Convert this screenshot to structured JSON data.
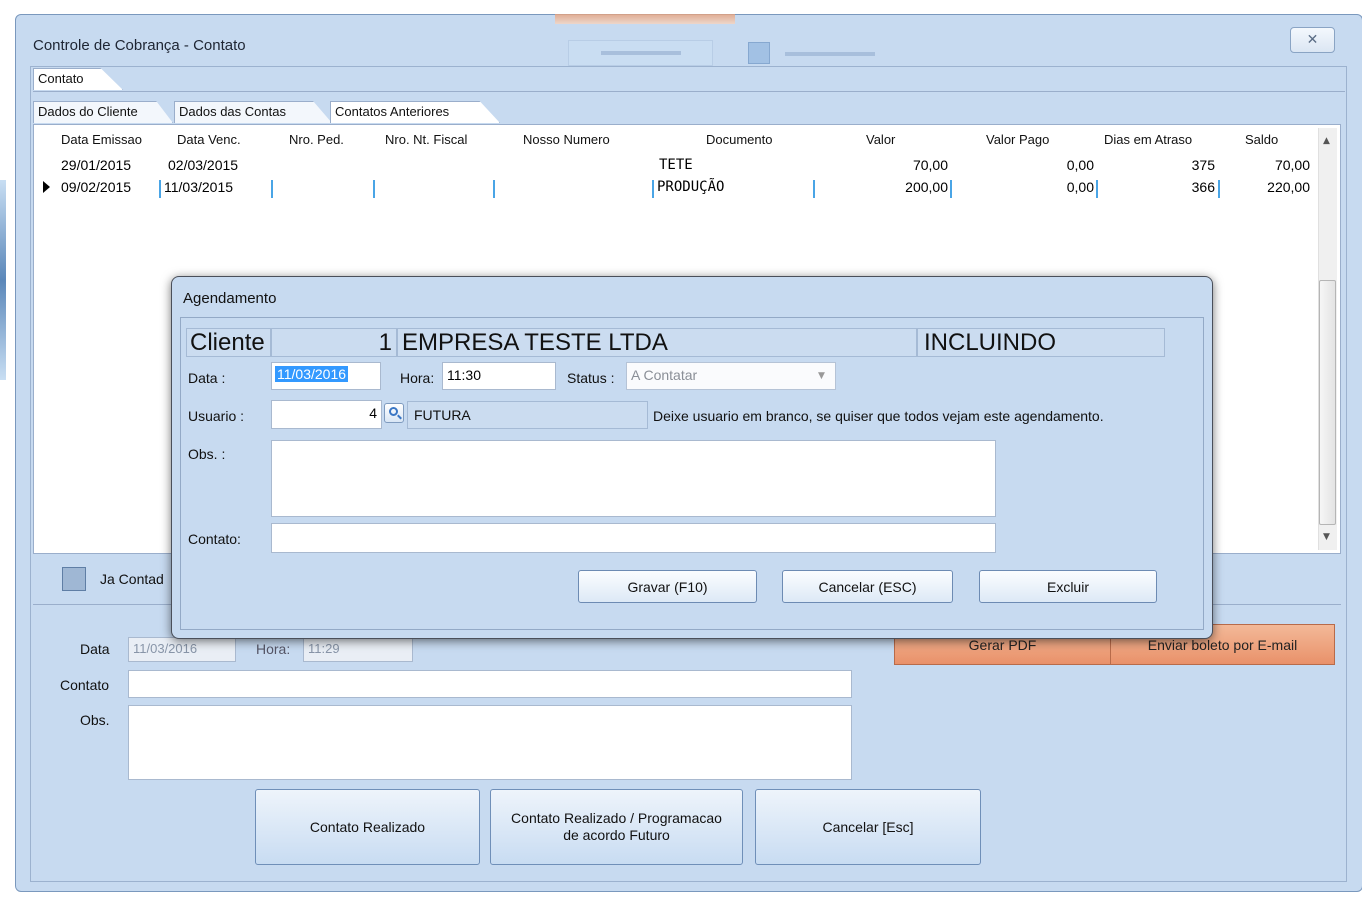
{
  "window": {
    "title": "Controle de Cobrança - Contato",
    "close_glyph": "✕"
  },
  "tabs": {
    "outer": "Contato",
    "inner": [
      "Dados do Cliente",
      "Dados das Contas",
      "Contatos Anteriores"
    ]
  },
  "grid": {
    "columns": [
      "Data Emissao",
      "Data Venc.",
      "Nro. Ped.",
      "Nro. Nt. Fiscal",
      "Nosso Numero",
      "Documento",
      "Valor",
      "Valor Pago",
      "Dias em Atraso",
      "Saldo"
    ],
    "rows": [
      {
        "data_emissao": "29/01/2015",
        "data_venc": "02/03/2015",
        "documento": "TETE",
        "valor": "70,00",
        "valor_pago": "0,00",
        "dias_atraso": "375",
        "saldo": "70,00"
      },
      {
        "data_emissao": "09/02/2015",
        "data_venc": "11/03/2015",
        "documento": "PRODUÇÃO",
        "valor": "200,00",
        "valor_pago": "0,00",
        "dias_atraso": "366",
        "saldo": "220,00"
      }
    ]
  },
  "lower": {
    "checkbox_label": "Ja Contad",
    "data_label": "Data",
    "data_value": "11/03/2016",
    "hora_label": "Hora:",
    "hora_value": "11:29",
    "contato_label": "Contato",
    "obs_label": "Obs.",
    "gerar_pdf": "Gerar PDF",
    "enviar_boleto": "Enviar boleto por E-mail",
    "btn_realizado": "Contato Realizado",
    "btn_programacao": "Contato Realizado / Programacao de acordo Futuro",
    "btn_cancelar": "Cancelar [Esc]"
  },
  "modal": {
    "title": "Agendamento",
    "cliente_label": "Cliente",
    "cliente_id": "1",
    "cliente_nome": "EMPRESA TESTE LTDA",
    "modo": "INCLUINDO",
    "data_label": "Data :",
    "data_value": "11/03/2016",
    "hora_label": "Hora:",
    "hora_value": "11:30",
    "status_label": "Status :",
    "status_value": "A Contatar",
    "usuario_label": "Usuario :",
    "usuario_id": "4",
    "usuario_nome": "FUTURA",
    "usuario_hint": "Deixe usuario em branco, se quiser que todos vejam este agendamento.",
    "obs_label": "Obs. :",
    "contato_label": "Contato:",
    "btn_gravar": "Gravar (F10)",
    "btn_cancelar": "Cancelar (ESC)",
    "btn_excluir": "Excluir"
  }
}
